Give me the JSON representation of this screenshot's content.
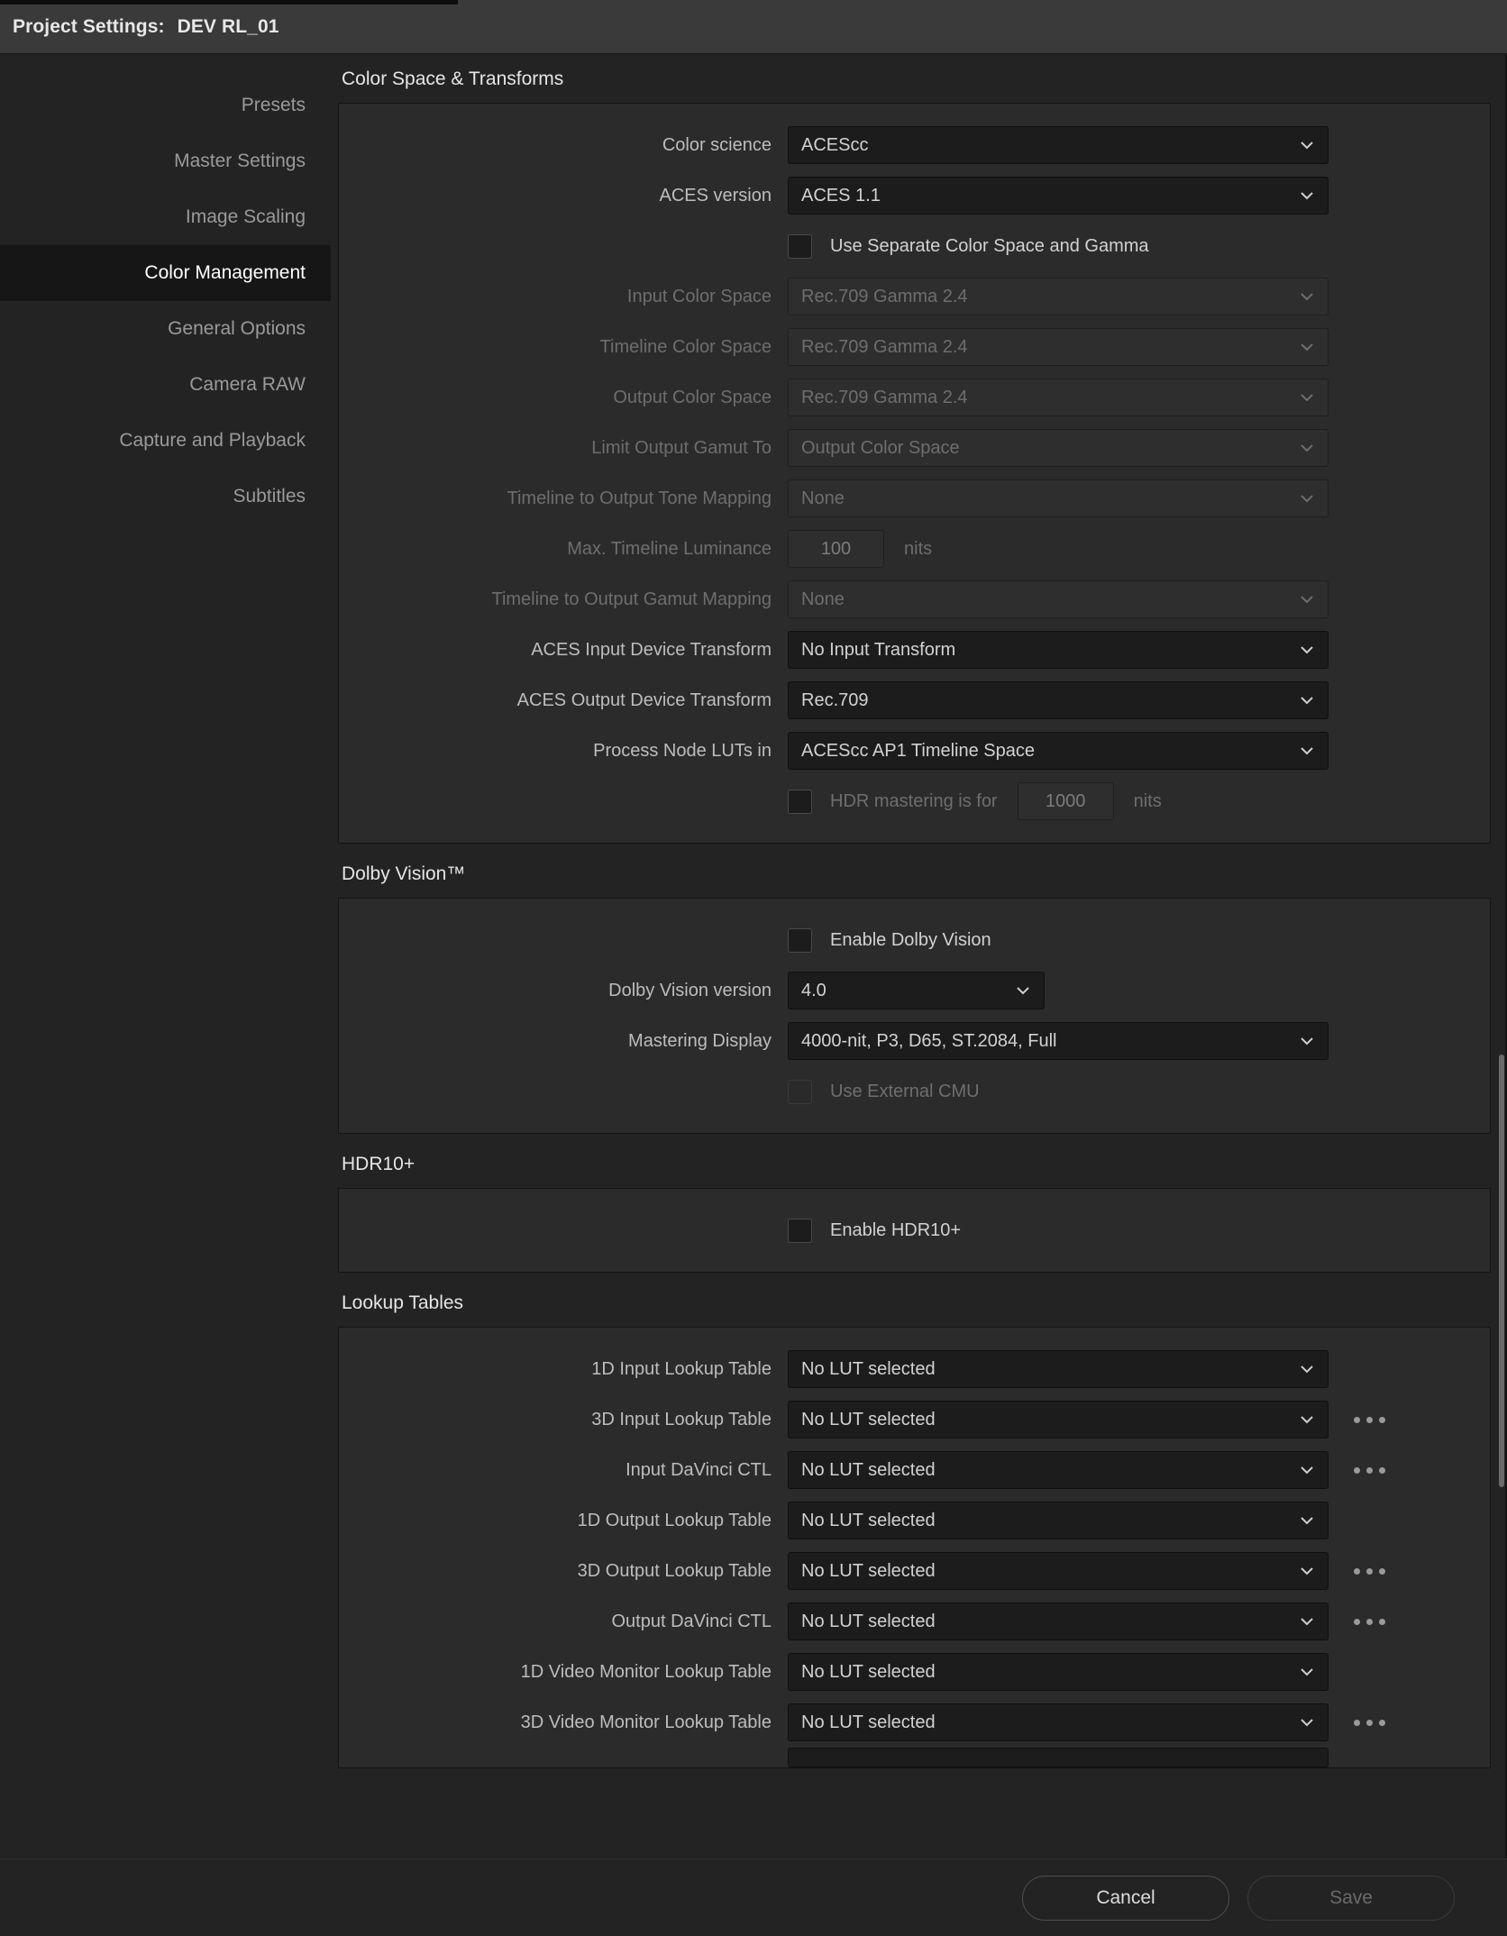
{
  "window": {
    "title_prefix": "Project Settings:",
    "project_name": "DEV RL_01"
  },
  "sidebar": {
    "items": [
      {
        "label": "Presets",
        "active": false
      },
      {
        "label": "Master Settings",
        "active": false
      },
      {
        "label": "Image Scaling",
        "active": false
      },
      {
        "label": "Color Management",
        "active": true
      },
      {
        "label": "General Options",
        "active": false
      },
      {
        "label": "Camera RAW",
        "active": false
      },
      {
        "label": "Capture and Playback",
        "active": false
      },
      {
        "label": "Subtitles",
        "active": false
      }
    ]
  },
  "sections": {
    "color_space": {
      "title": "Color Space & Transforms",
      "color_science": {
        "label": "Color science",
        "value": "ACEScc",
        "enabled": true
      },
      "aces_version": {
        "label": "ACES version",
        "value": "ACES 1.1",
        "enabled": true
      },
      "use_separate": {
        "label": "Use Separate Color Space and Gamma",
        "checked": false,
        "enabled": true
      },
      "input_color_space": {
        "label": "Input Color Space",
        "value": "Rec.709 Gamma 2.4",
        "enabled": false
      },
      "timeline_color_space": {
        "label": "Timeline Color Space",
        "value": "Rec.709 Gamma 2.4",
        "enabled": false
      },
      "output_color_space": {
        "label": "Output Color Space",
        "value": "Rec.709 Gamma 2.4",
        "enabled": false
      },
      "limit_output_gamut": {
        "label": "Limit Output Gamut To",
        "value": "Output Color Space",
        "enabled": false
      },
      "tone_mapping": {
        "label": "Timeline to Output Tone Mapping",
        "value": "None",
        "enabled": false
      },
      "max_luminance": {
        "label": "Max. Timeline Luminance",
        "value": "100",
        "unit": "nits",
        "enabled": false
      },
      "gamut_mapping": {
        "label": "Timeline to Output Gamut Mapping",
        "value": "None",
        "enabled": false
      },
      "aces_idt": {
        "label": "ACES Input Device Transform",
        "value": "No Input Transform",
        "enabled": true
      },
      "aces_odt": {
        "label": "ACES Output Device Transform",
        "value": "Rec.709",
        "enabled": true
      },
      "process_node_luts": {
        "label": "Process Node LUTs in",
        "value": "ACEScc AP1 Timeline Space",
        "enabled": true
      },
      "hdr_mastering": {
        "label": "HDR mastering is for",
        "checked": false,
        "value": "1000",
        "unit": "nits"
      }
    },
    "dolby_vision": {
      "title": "Dolby Vision™",
      "enable": {
        "label": "Enable Dolby Vision",
        "checked": false,
        "enabled": true
      },
      "version": {
        "label": "Dolby Vision version",
        "value": "4.0",
        "enabled": true
      },
      "mastering_display": {
        "label": "Mastering Display",
        "value": "4000-nit, P3, D65, ST.2084, Full",
        "enabled": true
      },
      "external_cmu": {
        "label": "Use External CMU",
        "checked": false,
        "enabled": false
      }
    },
    "hdr10": {
      "title": "HDR10+",
      "enable": {
        "label": "Enable HDR10+",
        "checked": false,
        "enabled": true
      }
    },
    "lookup_tables": {
      "title": "Lookup Tables",
      "rows": [
        {
          "label": "1D Input Lookup Table",
          "value": "No LUT selected",
          "has_browse": false
        },
        {
          "label": "3D Input Lookup Table",
          "value": "No LUT selected",
          "has_browse": true
        },
        {
          "label": "Input DaVinci CTL",
          "value": "No LUT selected",
          "has_browse": true
        },
        {
          "label": "1D Output Lookup Table",
          "value": "No LUT selected",
          "has_browse": false
        },
        {
          "label": "3D Output Lookup Table",
          "value": "No LUT selected",
          "has_browse": true
        },
        {
          "label": "Output DaVinci CTL",
          "value": "No LUT selected",
          "has_browse": true
        },
        {
          "label": "1D Video Monitor Lookup Table",
          "value": "No LUT selected",
          "has_browse": false
        },
        {
          "label": "3D Video Monitor Lookup Table",
          "value": "No LUT selected",
          "has_browse": true
        }
      ]
    }
  },
  "footer": {
    "cancel_label": "Cancel",
    "save_label": "Save",
    "save_enabled": false
  },
  "colors": {
    "window_bg": "#232323",
    "titlebar_bg": "#3a3a3a",
    "panel_bg": "#2b2b2b",
    "active_item_bg": "#161616",
    "control_bg": "#1c1c1c",
    "text_primary": "#e6e6e6",
    "text_dim": "#6e6e6e"
  }
}
